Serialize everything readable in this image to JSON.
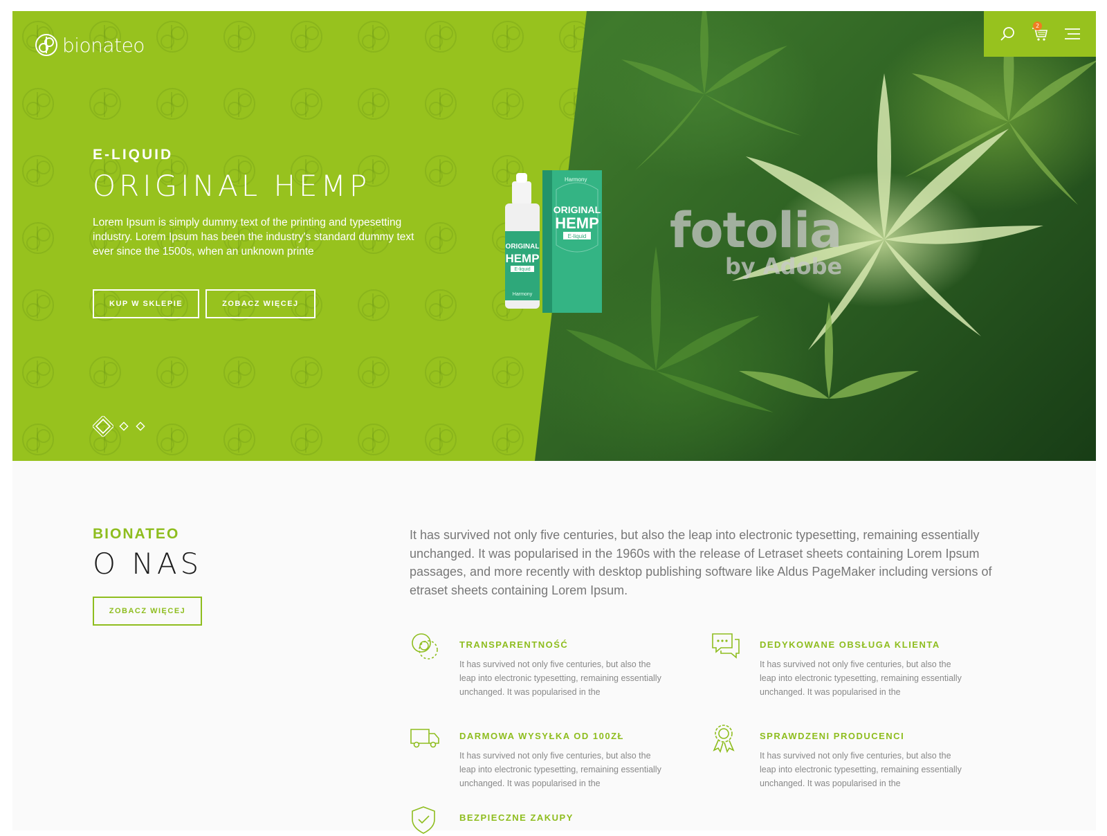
{
  "brand": {
    "name": "bionateo"
  },
  "header": {
    "cart_count": "2",
    "icons": [
      "search-icon",
      "cart-icon",
      "menu-icon"
    ]
  },
  "hero": {
    "eyebrow": "E-LIQUID",
    "title": "ORIGINAL HEMP",
    "description": "Lorem Ipsum is simply dummy text of the printing and typesetting industry. Lorem Ipsum has been the industry's standard dummy text ever since the 1500s, when an unknown printe",
    "buttons": [
      "KUP W SKLEPIE",
      "ZOBACZ WIĘCEJ"
    ],
    "watermark": {
      "main": "fotolia",
      "sub": "by Adobe"
    },
    "product": {
      "box_brand": "Harmony",
      "box_line1": "ORIGINAL",
      "box_line2": "HEMP",
      "box_line3": "E-liquid",
      "bottle_line1": "ORIGINAL",
      "bottle_line2": "HEMP",
      "bottle_line3": "E-liquid",
      "bottle_brand": "Harmony"
    },
    "slides_total": 3,
    "active_slide": 1,
    "colors": {
      "accent": "#97c21e"
    }
  },
  "about": {
    "eyebrow": "BIONATEO",
    "title": "O NAS",
    "button": "ZOBACZ WIĘCEJ",
    "text": "It has survived not only five centuries, but also the leap into electronic typesetting, remaining essentially unchanged. It was popularised in the 1960s with the release of Letraset sheets containing Lorem Ipsum passages, and more recently with desktop publishing software like Aldus PageMaker including versions of etraset sheets containing Lorem Ipsum."
  },
  "features": [
    {
      "icon": "circles-icon",
      "title": "TRANSPARENTNOŚĆ",
      "text": "It has survived not only five centuries, but also the leap into electronic typesetting, remaining essentially unchanged. It was popularised in the"
    },
    {
      "icon": "chat-icon",
      "title": "DEDYKOWANE OBSŁUGA KLIENTA",
      "text": "It has survived not only five centuries, but also the leap into electronic typesetting, remaining essentially unchanged. It was popularised in the"
    },
    {
      "icon": "truck-icon",
      "title": "DARMOWA WYSYŁKA OD 100ZŁ",
      "text": "It has survived not only five centuries, but also the leap into electronic typesetting, remaining essentially unchanged. It was popularised in the"
    },
    {
      "icon": "award-icon",
      "title": "SPRAWDZENI PRODUCENCI",
      "text": "It has survived not only five centuries, but also the leap into electronic typesetting, remaining essentially unchanged. It was popularised in the"
    },
    {
      "icon": "shield-check-icon",
      "title": "BEZPIECZNE ZAKUPY",
      "text": ""
    }
  ]
}
